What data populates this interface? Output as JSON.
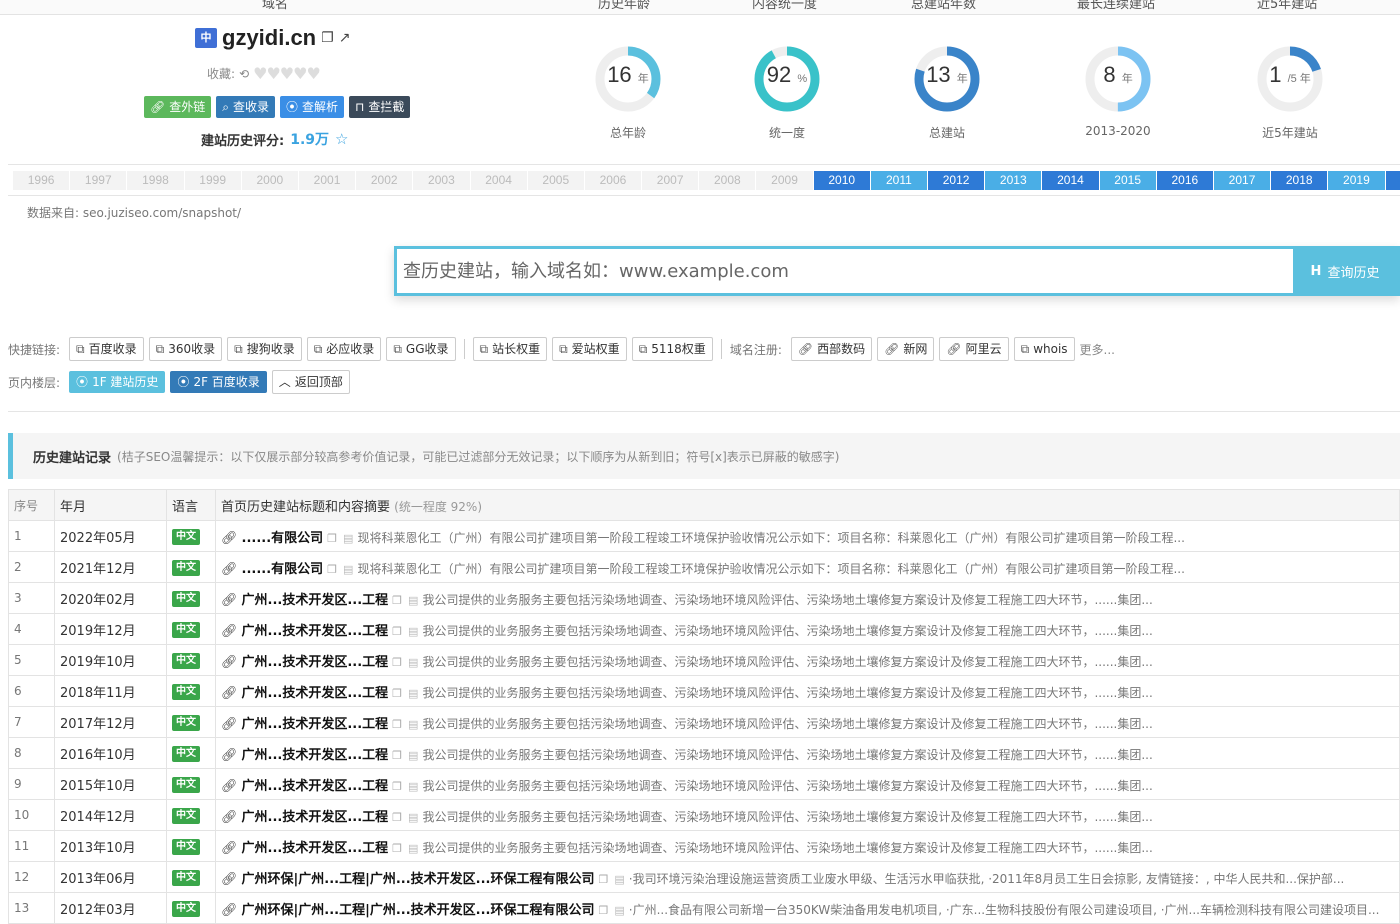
{
  "header_columns": [
    "域名",
    "历史年龄",
    "内容统一度",
    "总建站年数",
    "最长连续建站",
    "近5年建站"
  ],
  "domain": {
    "lang_badge": "中",
    "name": "gzyidi.cn",
    "collect_label": "收藏:",
    "buttons": [
      "查外链",
      "查收录",
      "查解析",
      "查拦截"
    ],
    "score_label": "建站历史评分:",
    "score_value": "1.9万"
  },
  "gauges": [
    {
      "value": "16",
      "unit": "年",
      "label": "总年龄",
      "fraction": 0.35,
      "color": "#5bc0de"
    },
    {
      "value": "92",
      "unit": "%",
      "label": "统一度",
      "fraction": 0.92,
      "color": "#39c2c9"
    },
    {
      "value": "13",
      "unit": "年",
      "label": "总建站",
      "fraction": 0.8,
      "color": "#3a84c9"
    },
    {
      "value": "8",
      "unit": "年",
      "label": "2013-2020",
      "fraction": 0.5,
      "color": "#7cc3f2"
    },
    {
      "value": "1",
      "unit": "/5 年",
      "label": "近5年建站",
      "fraction": 0.2,
      "color": "#3a84c9"
    }
  ],
  "years": [
    "1996",
    "1997",
    "1998",
    "1999",
    "2000",
    "2001",
    "2002",
    "2003",
    "2004",
    "2005",
    "2006",
    "2007",
    "2008",
    "2009",
    "2010",
    "2011",
    "2012",
    "2013",
    "2014",
    "2015",
    "2016",
    "2017",
    "2018",
    "2019",
    ""
  ],
  "years_active_from": 14,
  "source": "数据来自: seo.juziseo.com/snapshot/",
  "search": {
    "placeholder": "查历史建站，输入域名如：www.example.com",
    "button": "查询历史"
  },
  "quicklinks": {
    "label": "快捷链接:",
    "group1": [
      "百度收录",
      "360收录",
      "搜狗收录",
      "必应收录",
      "GG收录"
    ],
    "group2": [
      "站长权重",
      "爱站权重",
      "5118权重"
    ],
    "register_label": "域名注册:",
    "group3": [
      "西部数码",
      "新网",
      "阿里云",
      "whois"
    ],
    "more": "更多..."
  },
  "floors": {
    "label": "页内楼层:",
    "f1": "1F 建站历史",
    "f2": "2F 百度收录",
    "top": "返回顶部"
  },
  "section": {
    "title": "历史建站记录",
    "note": "(桔子SEO温馨提示：以下仅展示部分较高参考价值记录，可能已过滤部分无效记录；以下顺序为从新到旧；符号[x]表示已屏蔽的敏感字)"
  },
  "table": {
    "headers": {
      "idx": "序号",
      "date": "年月",
      "lang": "语言",
      "content": "首页历史建站标题和内容摘要",
      "extra": "(统一程度 92%)"
    },
    "rows": [
      {
        "idx": "1",
        "date": "2022年05月",
        "lang": "中文",
        "title": "......有限公司",
        "summary": "现将科莱恩化工（广州）有限公司扩建项目第一阶段工程竣工环境保护验收情况公示如下：项目名称：科莱恩化工（广州）有限公司扩建项目第一阶段工程..."
      },
      {
        "idx": "2",
        "date": "2021年12月",
        "lang": "中文",
        "title": "......有限公司",
        "summary": "现将科莱恩化工（广州）有限公司扩建项目第一阶段工程竣工环境保护验收情况公示如下：项目名称：科莱恩化工（广州）有限公司扩建项目第一阶段工程..."
      },
      {
        "idx": "3",
        "date": "2020年02月",
        "lang": "中文",
        "title": "广州...技术开发区...工程",
        "summary": "我公司提供的业务服务主要包括污染场地调查、污染场地环境风险评估、污染场地土壤修复方案设计及修复工程施工四大环节，......集团..."
      },
      {
        "idx": "4",
        "date": "2019年12月",
        "lang": "中文",
        "title": "广州...技术开发区...工程",
        "summary": "我公司提供的业务服务主要包括污染场地调查、污染场地环境风险评估、污染场地土壤修复方案设计及修复工程施工四大环节，......集团..."
      },
      {
        "idx": "5",
        "date": "2019年10月",
        "lang": "中文",
        "title": "广州...技术开发区...工程",
        "summary": "我公司提供的业务服务主要包括污染场地调查、污染场地环境风险评估、污染场地土壤修复方案设计及修复工程施工四大环节，......集团..."
      },
      {
        "idx": "6",
        "date": "2018年11月",
        "lang": "中文",
        "title": "广州...技术开发区...工程",
        "summary": "我公司提供的业务服务主要包括污染场地调查、污染场地环境风险评估、污染场地土壤修复方案设计及修复工程施工四大环节，......集团..."
      },
      {
        "idx": "7",
        "date": "2017年12月",
        "lang": "中文",
        "title": "广州...技术开发区...工程",
        "summary": "我公司提供的业务服务主要包括污染场地调查、污染场地环境风险评估、污染场地土壤修复方案设计及修复工程施工四大环节，......集团..."
      },
      {
        "idx": "8",
        "date": "2016年10月",
        "lang": "中文",
        "title": "广州...技术开发区...工程",
        "summary": "我公司提供的业务服务主要包括污染场地调查、污染场地环境风险评估、污染场地土壤修复方案设计及修复工程施工四大环节，......集团..."
      },
      {
        "idx": "9",
        "date": "2015年10月",
        "lang": "中文",
        "title": "广州...技术开发区...工程",
        "summary": "我公司提供的业务服务主要包括污染场地调查、污染场地环境风险评估、污染场地土壤修复方案设计及修复工程施工四大环节，......集团..."
      },
      {
        "idx": "10",
        "date": "2014年12月",
        "lang": "中文",
        "title": "广州...技术开发区...工程",
        "summary": "我公司提供的业务服务主要包括污染场地调查、污染场地环境风险评估、污染场地土壤修复方案设计及修复工程施工四大环节，......集团..."
      },
      {
        "idx": "11",
        "date": "2013年10月",
        "lang": "中文",
        "title": "广州...技术开发区...工程",
        "summary": "我公司提供的业务服务主要包括污染场地调查、污染场地环境风险评估、污染场地土壤修复方案设计及修复工程施工四大环节，......集团..."
      },
      {
        "idx": "12",
        "date": "2013年06月",
        "lang": "中文",
        "title": "广州环保|广州...工程|广州...技术开发区...环保工程有限公司",
        "summary": "·我司环境污染治理设施运营资质工业废水甲级、生活污水甲临获批, ·2011年8月员工生日会掠影, 友情链接：, 中华人民共和...保护部..."
      },
      {
        "idx": "13",
        "date": "2012年03月",
        "lang": "中文",
        "title": "广州环保|广州...工程|广州...技术开发区...环保工程有限公司",
        "summary": "·广州...食品有限公司新增一台350KW柴油备用发电机项目, ·广东...生物科技股份有限公司建设项目, ·广州...车辆检测科技有限公司建设项目..."
      }
    ]
  }
}
